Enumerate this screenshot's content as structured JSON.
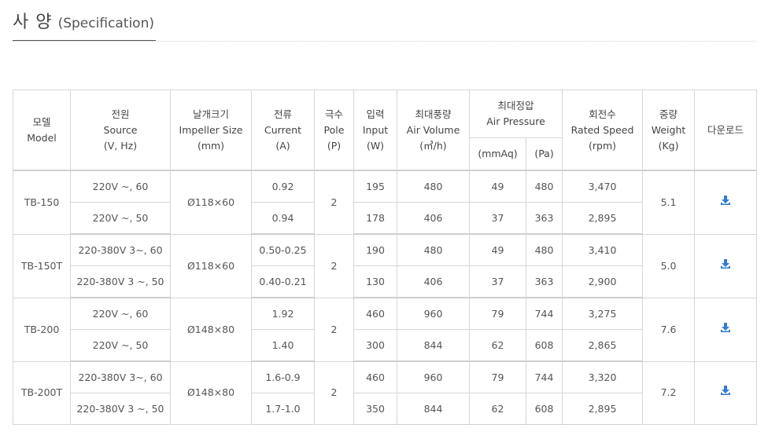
{
  "title": {
    "ko": "사 양",
    "en": "(Specification)"
  },
  "headers": {
    "model": [
      "모델",
      "Model"
    ],
    "source": [
      "전원",
      "Source",
      "(V, Hz)"
    ],
    "impeller": [
      "날개크기",
      "Impeller Size",
      "(mm)"
    ],
    "current": [
      "전류",
      "Current",
      "(A)"
    ],
    "pole": [
      "극수",
      "Pole",
      "(P)"
    ],
    "input": [
      "입력",
      "Input",
      "(W)"
    ],
    "air_volume": [
      "최대풍량",
      "Air Volume",
      "(㎥/h)"
    ],
    "air_pressure": [
      "최대정압",
      "Air Pressure"
    ],
    "mmaq": "(mmAq)",
    "pa": "(Pa)",
    "speed": [
      "회전수",
      "Rated Speed",
      "(rpm)"
    ],
    "weight": [
      "중량",
      "Weight",
      "(Kg)"
    ],
    "download": "다운로드"
  },
  "models": [
    {
      "name": "TB-150",
      "impeller": "Ø118×60",
      "pole": "2",
      "weight": "5.1",
      "rows": [
        {
          "source": "220V ~, 60",
          "current": "0.92",
          "input": "195",
          "volume": "480",
          "mmaq": "49",
          "pa": "480",
          "speed": "3,470"
        },
        {
          "source": "220V ~, 50",
          "current": "0.94",
          "input": "178",
          "volume": "406",
          "mmaq": "37",
          "pa": "363",
          "speed": "2,895"
        }
      ]
    },
    {
      "name": "TB-150T",
      "impeller": "Ø118×60",
      "pole": "2",
      "weight": "5.0",
      "rows": [
        {
          "source": "220-380V 3~, 60",
          "current": "0.50-0.25",
          "input": "190",
          "volume": "480",
          "mmaq": "49",
          "pa": "480",
          "speed": "3,410"
        },
        {
          "source": "220-380V 3 ~, 50",
          "current": "0.40-0.21",
          "input": "130",
          "volume": "406",
          "mmaq": "37",
          "pa": "363",
          "speed": "2,900"
        }
      ]
    },
    {
      "name": "TB-200",
      "impeller": "Ø148×80",
      "pole": "2",
      "weight": "7.6",
      "rows": [
        {
          "source": "220V ~, 60",
          "current": "1.92",
          "input": "460",
          "volume": "960",
          "mmaq": "79",
          "pa": "744",
          "speed": "3,275"
        },
        {
          "source": "220V ~, 50",
          "current": "1.40",
          "input": "300",
          "volume": "844",
          "mmaq": "62",
          "pa": "608",
          "speed": "2,865"
        }
      ]
    },
    {
      "name": "TB-200T",
      "impeller": "Ø148×80",
      "pole": "2",
      "weight": "7.2",
      "rows": [
        {
          "source": "220-380V 3~, 60",
          "current": "1.6-0.9",
          "input": "460",
          "volume": "960",
          "mmaq": "79",
          "pa": "744",
          "speed": "3,320"
        },
        {
          "source": "220-380V 3 ~, 50",
          "current": "1.7-1.0",
          "input": "350",
          "volume": "844",
          "mmaq": "62",
          "pa": "608",
          "speed": "2,895"
        }
      ]
    }
  ],
  "colors": {
    "download_icon": "#2f7bd6",
    "border": "#d6d6d6"
  },
  "icons": {
    "download": "download-icon"
  }
}
